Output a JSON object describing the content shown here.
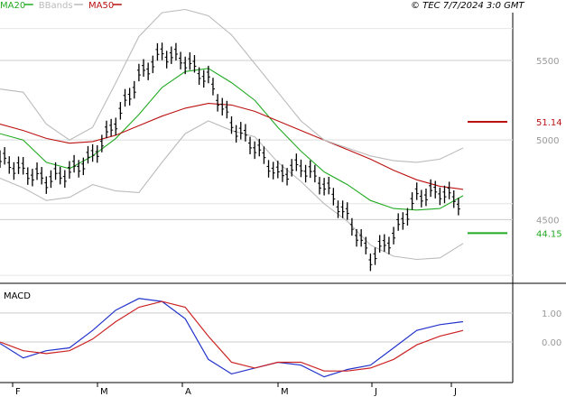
{
  "header": {
    "legend": [
      {
        "label": "MA20",
        "color": "#22aa22"
      },
      {
        "label": "BBands",
        "color": "#bbbbbb"
      },
      {
        "label": "MA50",
        "color": "#bb1111"
      }
    ],
    "timestamp": "© TEC 7/7/2024 3:0 GMT"
  },
  "colors": {
    "price": "#000000",
    "ma20": "#22aa22",
    "ma50": "#bb1111",
    "bbands": "#bbbbbb",
    "macd": "#2233cc",
    "signal": "#cc2222",
    "grid": "#cccccc",
    "axis": "#000000"
  },
  "chart_data": [
    {
      "type": "line",
      "panel": "price",
      "title": "",
      "x": [
        "F",
        "M",
        "A",
        "M",
        "J",
        "J"
      ],
      "ylim": [
        4100,
        5800
      ],
      "y_ticks": [
        4500,
        5000,
        5500
      ],
      "y_tick_labels": [
        "4500",
        "5000",
        "5500"
      ],
      "tags": [
        {
          "label": "51.14",
          "value": 5114,
          "series": "MA50"
        },
        {
          "label": "44.15",
          "value": 4415,
          "series": "MA20"
        }
      ],
      "series": [
        {
          "name": "MA20",
          "points": [
            [
              0,
              5040
            ],
            [
              10,
              5000
            ],
            [
              20,
              4860
            ],
            [
              30,
              4820
            ],
            [
              40,
              4900
            ],
            [
              50,
              5010
            ],
            [
              60,
              5160
            ],
            [
              70,
              5330
            ],
            [
              80,
              5430
            ],
            [
              90,
              5450
            ],
            [
              100,
              5360
            ],
            [
              110,
              5250
            ],
            [
              120,
              5080
            ],
            [
              130,
              4930
            ],
            [
              140,
              4800
            ],
            [
              150,
              4720
            ],
            [
              160,
              4620
            ],
            [
              170,
              4570
            ],
            [
              180,
              4560
            ],
            [
              190,
              4570
            ],
            [
              200,
              4650
            ]
          ]
        },
        {
          "name": "MA50",
          "points": [
            [
              0,
              5100
            ],
            [
              10,
              5060
            ],
            [
              20,
              5010
            ],
            [
              30,
              4980
            ],
            [
              40,
              4990
            ],
            [
              50,
              5030
            ],
            [
              60,
              5090
            ],
            [
              70,
              5150
            ],
            [
              80,
              5200
            ],
            [
              90,
              5230
            ],
            [
              100,
              5220
            ],
            [
              110,
              5180
            ],
            [
              120,
              5120
            ],
            [
              130,
              5060
            ],
            [
              140,
              5000
            ],
            [
              150,
              4940
            ],
            [
              160,
              4880
            ],
            [
              170,
              4810
            ],
            [
              180,
              4750
            ],
            [
              190,
              4710
            ],
            [
              200,
              4690
            ]
          ]
        },
        {
          "name": "BBands upper",
          "points": [
            [
              0,
              5320
            ],
            [
              10,
              5300
            ],
            [
              20,
              5100
            ],
            [
              30,
              5000
            ],
            [
              40,
              5080
            ],
            [
              50,
              5360
            ],
            [
              60,
              5650
            ],
            [
              70,
              5800
            ],
            [
              80,
              5820
            ],
            [
              90,
              5780
            ],
            [
              100,
              5660
            ],
            [
              110,
              5480
            ],
            [
              120,
              5300
            ],
            [
              130,
              5120
            ],
            [
              140,
              5000
            ],
            [
              150,
              4950
            ],
            [
              160,
              4900
            ],
            [
              170,
              4870
            ],
            [
              180,
              4860
            ],
            [
              190,
              4880
            ],
            [
              200,
              4950
            ]
          ]
        },
        {
          "name": "BBands lower",
          "points": [
            [
              0,
              4760
            ],
            [
              10,
              4700
            ],
            [
              20,
              4620
            ],
            [
              30,
              4640
            ],
            [
              40,
              4720
            ],
            [
              50,
              4680
            ],
            [
              60,
              4670
            ],
            [
              70,
              4860
            ],
            [
              80,
              5040
            ],
            [
              90,
              5120
            ],
            [
              100,
              5060
            ],
            [
              110,
              5020
            ],
            [
              120,
              4860
            ],
            [
              130,
              4740
            ],
            [
              140,
              4600
            ],
            [
              150,
              4490
            ],
            [
              160,
              4340
            ],
            [
              170,
              4270
            ],
            [
              180,
              4250
            ],
            [
              190,
              4260
            ],
            [
              200,
              4350
            ]
          ]
        },
        {
          "name": "Price",
          "points": [
            [
              0,
              4880
            ],
            [
              10,
              4810
            ],
            [
              20,
              4750
            ],
            [
              30,
              4800
            ],
            [
              40,
              4900
            ],
            [
              50,
              5120
            ],
            [
              60,
              5400
            ],
            [
              70,
              5550
            ],
            [
              80,
              5500
            ],
            [
              90,
              5380
            ],
            [
              100,
              5100
            ],
            [
              110,
              4960
            ],
            [
              120,
              4780
            ],
            [
              130,
              4840
            ],
            [
              140,
              4720
            ],
            [
              150,
              4520
            ],
            [
              160,
              4260
            ],
            [
              170,
              4400
            ],
            [
              180,
              4650
            ],
            [
              190,
              4680
            ],
            [
              200,
              4600
            ]
          ]
        }
      ]
    },
    {
      "type": "line",
      "panel": "macd",
      "title": "MACD",
      "x": [
        "F",
        "M",
        "A",
        "M",
        "J",
        "J"
      ],
      "ylim": [
        -140,
        190
      ],
      "y_ticks": [
        0,
        100
      ],
      "y_tick_labels": [
        "0.00",
        "1.00"
      ],
      "series": [
        {
          "name": "MACD",
          "points": [
            [
              0,
              -5
            ],
            [
              10,
              -55
            ],
            [
              20,
              -30
            ],
            [
              30,
              -20
            ],
            [
              40,
              40
            ],
            [
              50,
              110
            ],
            [
              60,
              150
            ],
            [
              70,
              140
            ],
            [
              80,
              80
            ],
            [
              90,
              -60
            ],
            [
              100,
              -110
            ],
            [
              110,
              -90
            ],
            [
              120,
              -70
            ],
            [
              130,
              -80
            ],
            [
              140,
              -120
            ],
            [
              150,
              -95
            ],
            [
              160,
              -80
            ],
            [
              170,
              -20
            ],
            [
              180,
              40
            ],
            [
              190,
              60
            ],
            [
              200,
              70
            ]
          ]
        },
        {
          "name": "Signal",
          "points": [
            [
              0,
              0
            ],
            [
              10,
              -30
            ],
            [
              20,
              -40
            ],
            [
              30,
              -30
            ],
            [
              40,
              10
            ],
            [
              50,
              70
            ],
            [
              60,
              120
            ],
            [
              70,
              140
            ],
            [
              80,
              120
            ],
            [
              90,
              20
            ],
            [
              100,
              -70
            ],
            [
              110,
              -90
            ],
            [
              120,
              -70
            ],
            [
              130,
              -70
            ],
            [
              140,
              -100
            ],
            [
              150,
              -100
            ],
            [
              160,
              -90
            ],
            [
              170,
              -60
            ],
            [
              180,
              -10
            ],
            [
              190,
              20
            ],
            [
              200,
              40
            ]
          ]
        }
      ]
    }
  ]
}
